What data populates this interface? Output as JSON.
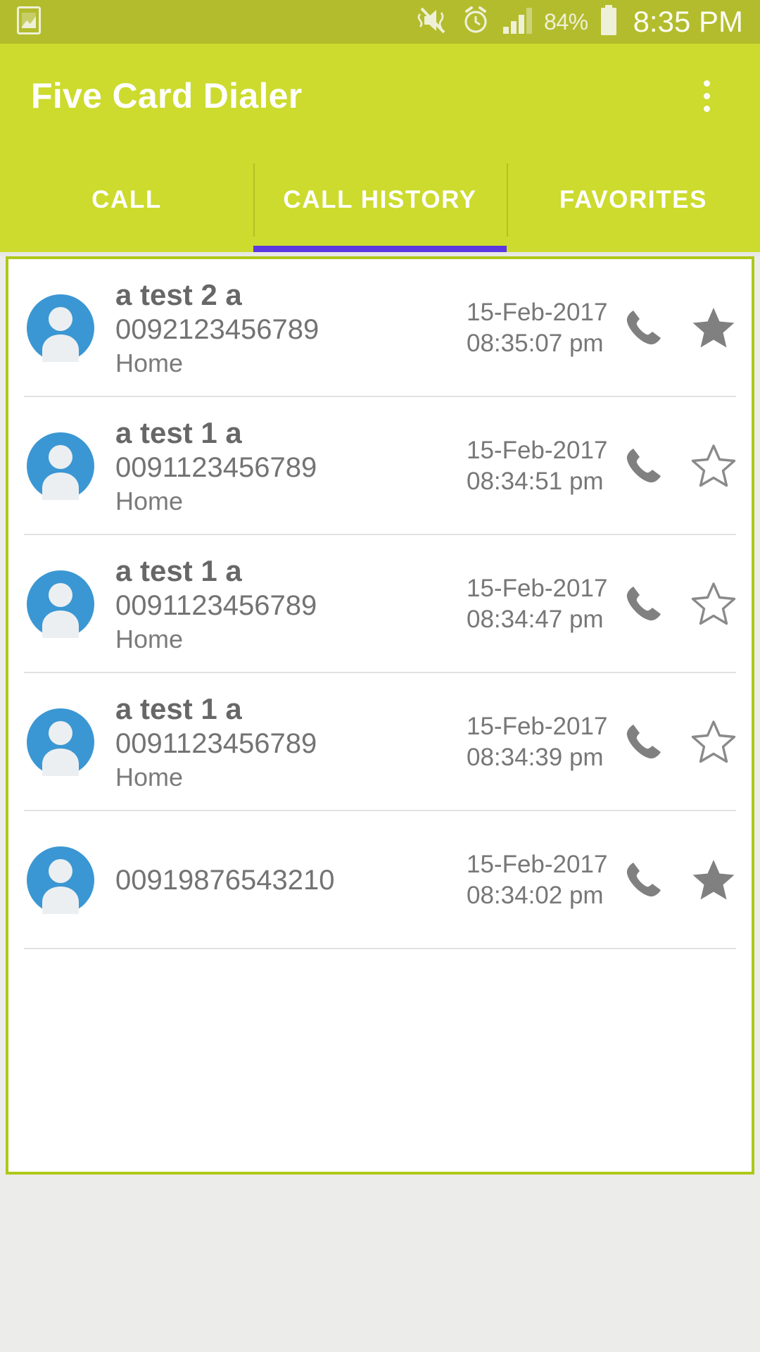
{
  "status_bar": {
    "left_icons": [
      {
        "name": "screenshot-icon",
        "label": "screenshot"
      }
    ],
    "right_icons": [
      {
        "name": "vibrate-mute-icon",
        "label": "sound off / vibrate"
      },
      {
        "name": "alarm-clock-icon",
        "label": "alarm set"
      },
      {
        "name": "signal-bars-icon",
        "label": "cellular signal"
      }
    ],
    "battery_percent": "84%",
    "battery_icon": "battery-icon",
    "time": "8:35 PM"
  },
  "app_bar": {
    "title": "Five Card Dialer",
    "overflow_menu": "overflow-menu-icon"
  },
  "tabs": {
    "items": [
      {
        "label": "CALL",
        "active": false
      },
      {
        "label": "CALL HISTORY",
        "active": true
      },
      {
        "label": "FAVORITES",
        "active": false
      }
    ],
    "active_index": 1,
    "indicator_color": "#5b37e0"
  },
  "call_history": {
    "rows": [
      {
        "avatar": "contact-avatar-icon",
        "name": "a test 2 a",
        "number": "0092123456789",
        "number_type": "Home",
        "date": "15-Feb-2017",
        "time": "08:35:07 pm",
        "call_action": "phone-icon",
        "favorite": true,
        "favorite_icon": "star-filled-icon"
      },
      {
        "avatar": "contact-avatar-icon",
        "name": "a test 1 a",
        "number": "0091123456789",
        "number_type": "Home",
        "date": "15-Feb-2017",
        "time": "08:34:51 pm",
        "call_action": "phone-icon",
        "favorite": false,
        "favorite_icon": "star-outline-icon"
      },
      {
        "avatar": "contact-avatar-icon",
        "name": "a test 1 a",
        "number": "0091123456789",
        "number_type": "Home",
        "date": "15-Feb-2017",
        "time": "08:34:47 pm",
        "call_action": "phone-icon",
        "favorite": false,
        "favorite_icon": "star-outline-icon"
      },
      {
        "avatar": "contact-avatar-icon",
        "name": "a test 1 a",
        "number": "0091123456789",
        "number_type": "Home",
        "date": "15-Feb-2017",
        "time": "08:34:39 pm",
        "call_action": "phone-icon",
        "favorite": false,
        "favorite_icon": "star-outline-icon"
      },
      {
        "avatar": "contact-avatar-icon",
        "name": "",
        "number": "00919876543210",
        "number_type": "",
        "date": "15-Feb-2017",
        "time": "08:34:02 pm",
        "call_action": "phone-icon",
        "favorite": true,
        "favorite_icon": "star-filled-icon"
      }
    ]
  },
  "colors": {
    "status_bar": "#b3bc2c",
    "app_bar": "#ccdb2d",
    "card_border": "#aec818",
    "avatar": "#3b97d3",
    "icon_gray": "#808080",
    "page_background": "#ececeb"
  }
}
